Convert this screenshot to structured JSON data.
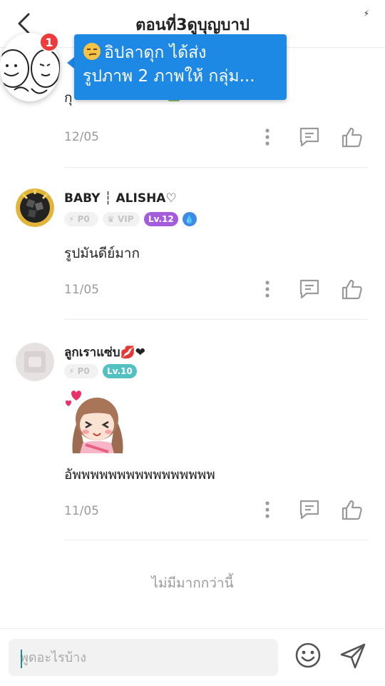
{
  "header": {
    "title": "ตอนที่3ดูบุญบาป"
  },
  "first_comment_partial": {
    "text": "กุ",
    "date": "12/05"
  },
  "comments": [
    {
      "name": "BABY ┆ ALISHA♡",
      "badges": {
        "p0": "P0",
        "vip": "VIP",
        "level": "Lv.12",
        "drop": "💧"
      },
      "text": "รูปมันดีย์มาก",
      "date": "11/05"
    },
    {
      "name": "ลูกเราแซ่บ💋❤",
      "badges": {
        "p0": "P0",
        "level": "Lv.10"
      },
      "text": "อัพพพพพพพพพพพพพพพพ",
      "date": "11/05"
    }
  ],
  "footer": {
    "no_more": "ไม่มีมากกว่านี้"
  },
  "input": {
    "placeholder": "พูดอะไรบ้าง"
  },
  "notification": {
    "badge_count": "1",
    "line1": "อิปลาดุก ได้ส่ง",
    "line2": "รูปภาพ 2 ภาพให้ กลุ่ม..."
  },
  "colors": {
    "accent_blue": "#1e88e5",
    "notif_red": "#ee3a3a",
    "lv_purple": "#a35ddc",
    "lv_teal": "#53c1c1"
  }
}
